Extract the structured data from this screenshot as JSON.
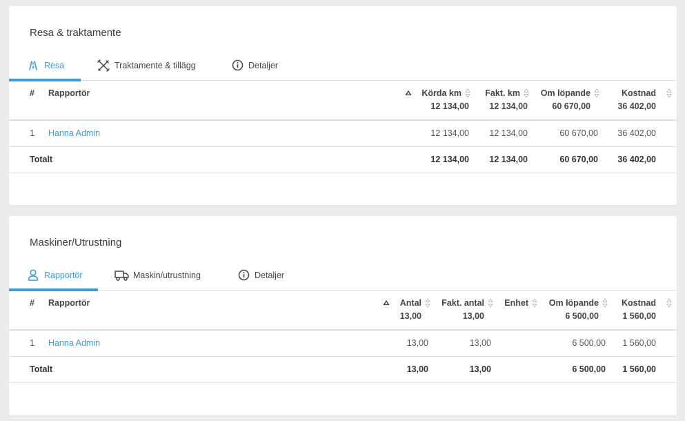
{
  "colors": {
    "accent": "#3a9bd5",
    "background": "#ececec",
    "card": "#ffffff"
  },
  "resa": {
    "title": "Resa & traktamente",
    "tabs": [
      {
        "label": "Resa",
        "icon": "road-icon",
        "active": true
      },
      {
        "label": "Traktamente & tillägg",
        "icon": "tools-icon",
        "active": false
      },
      {
        "label": "Detaljer",
        "icon": "info-icon",
        "active": false
      }
    ],
    "table": {
      "headers": {
        "num": "#",
        "reporter": "Rapportör",
        "driven_km": "Körda km",
        "billed_km": "Fakt. km",
        "om_lopande": "Om löpande",
        "cost": "Kostnad"
      },
      "header_totals": {
        "driven_km": "12 134,00",
        "billed_km": "12 134,00",
        "om_lopande": "60 670,00",
        "cost": "36 402,00"
      },
      "rows": [
        {
          "num": "1",
          "reporter": "Hanna Admin",
          "driven_km": "12 134,00",
          "billed_km": "12 134,00",
          "om_lopande": "60 670,00",
          "cost": "36 402,00"
        }
      ],
      "total": {
        "label": "Totalt",
        "driven_km": "12 134,00",
        "billed_km": "12 134,00",
        "om_lopande": "60 670,00",
        "cost": "36 402,00"
      }
    }
  },
  "maskiner": {
    "title": "Maskiner/Utrustning",
    "tabs": [
      {
        "label": "Rapportör",
        "icon": "user-icon",
        "active": true
      },
      {
        "label": "Maskin/utrustning",
        "icon": "truck-icon",
        "active": false
      },
      {
        "label": "Detaljer",
        "icon": "info-icon",
        "active": false
      }
    ],
    "table": {
      "headers": {
        "num": "#",
        "reporter": "Rapportör",
        "antal": "Antal",
        "fakt_antal": "Fakt. antal",
        "enhet": "Enhet",
        "om_lopande": "Om löpande",
        "cost": "Kostnad"
      },
      "header_totals": {
        "antal": "13,00",
        "fakt_antal": "13,00",
        "om_lopande": "6 500,00",
        "cost": "1 560,00"
      },
      "rows": [
        {
          "num": "1",
          "reporter": "Hanna Admin",
          "antal": "13,00",
          "fakt_antal": "13,00",
          "enhet": "",
          "om_lopande": "6 500,00",
          "cost": "1 560,00"
        }
      ],
      "total": {
        "label": "Totalt",
        "antal": "13,00",
        "fakt_antal": "13,00",
        "om_lopande": "6 500,00",
        "cost": "1 560,00"
      }
    }
  }
}
